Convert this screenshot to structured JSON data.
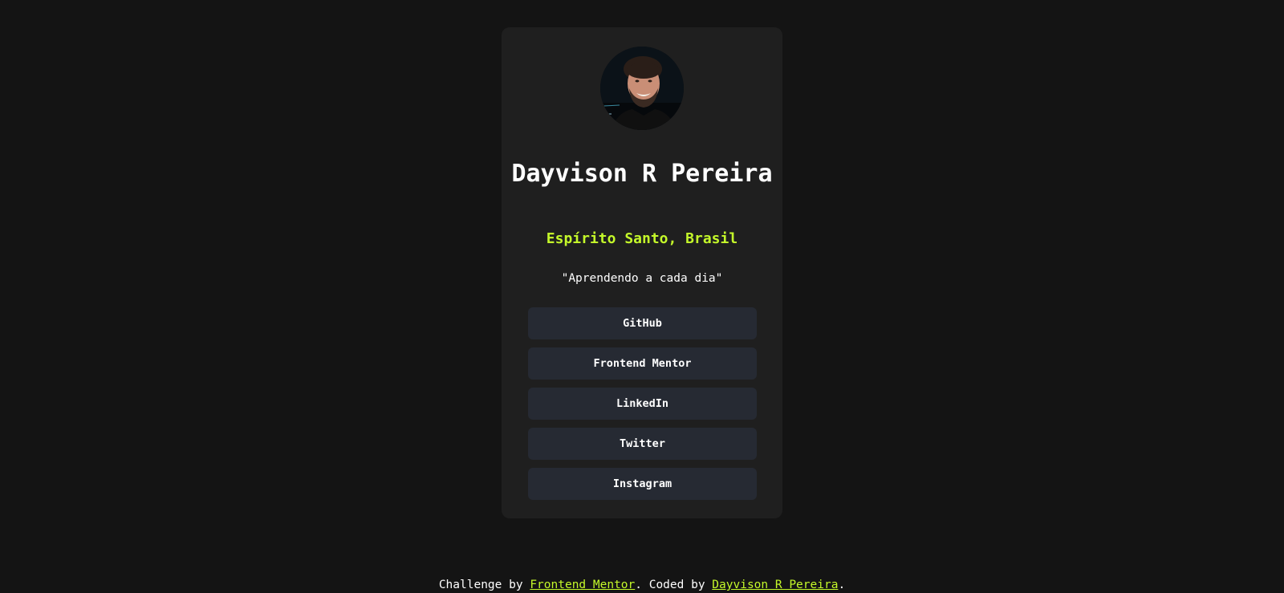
{
  "profile": {
    "avatar_alt": "Profile photo",
    "name": "Dayvison R Pereira",
    "location": "Espírito Santo, Brasil",
    "bio": "\"Aprendendo a cada dia\""
  },
  "links": [
    {
      "label": "GitHub"
    },
    {
      "label": "Frontend Mentor"
    },
    {
      "label": "LinkedIn"
    },
    {
      "label": "Twitter"
    },
    {
      "label": "Instagram"
    }
  ],
  "footer": {
    "prefix": "Challenge by ",
    "challenge_link": "Frontend Mentor",
    "middle": ". Coded by ",
    "author_link": "Dayvison R Pereira",
    "suffix": "."
  },
  "colors": {
    "background": "#141414",
    "card": "#1f1f1f",
    "button": "#262a33",
    "accent": "#c4f82a",
    "text": "#ffffff"
  }
}
